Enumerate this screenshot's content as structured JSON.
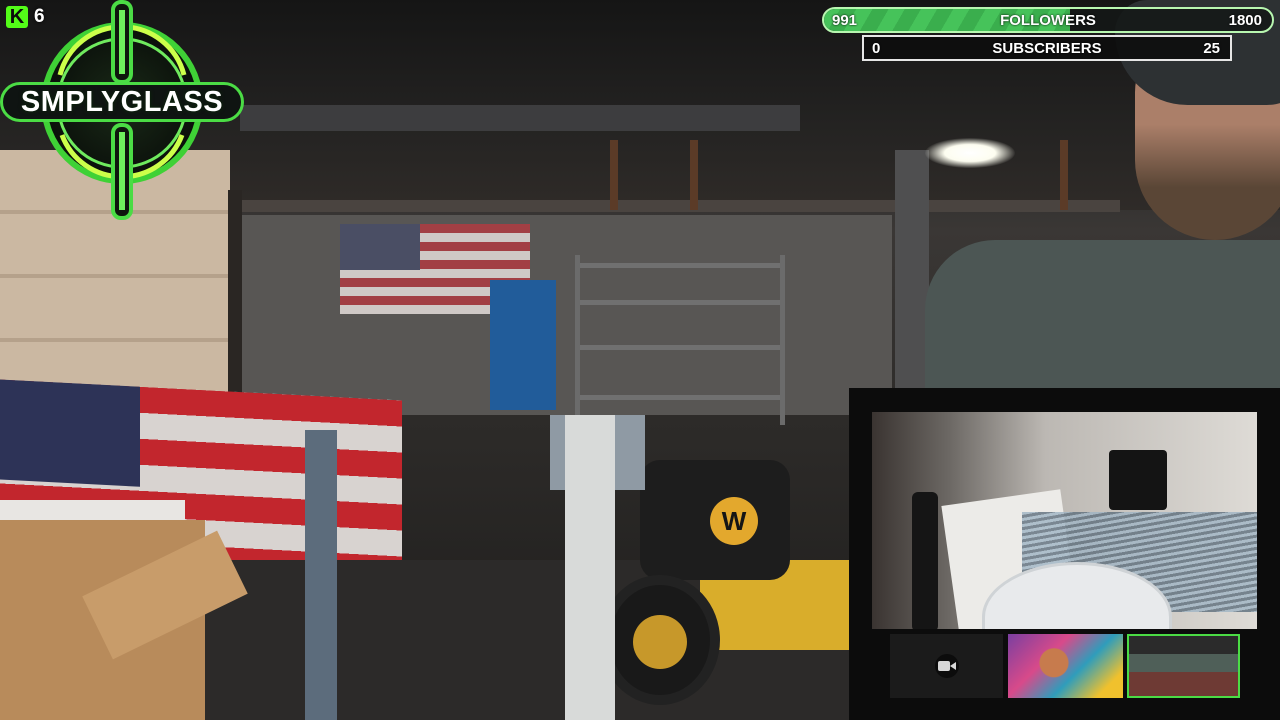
{
  "kick": {
    "icon": "kick-logo-icon",
    "letter": "K",
    "count": "6"
  },
  "brand": {
    "logo_text": "SMPLYGLASS",
    "accent": "#4bdc45"
  },
  "goals": {
    "followers": {
      "current": "991",
      "title": "FOLLOWERS",
      "target": "1800",
      "progress": 0.55
    },
    "subscribers": {
      "current": "0",
      "title": "SUBSCRIBERS",
      "target": "25",
      "progress": 0.0
    }
  },
  "camera_panel": {
    "thumbnails": [
      {
        "name": "camera-off",
        "icon": "video-camera-off-icon"
      },
      {
        "name": "guest-cam"
      },
      {
        "name": "scene-preview"
      }
    ]
  },
  "scene": {
    "mower_badge": "W"
  }
}
